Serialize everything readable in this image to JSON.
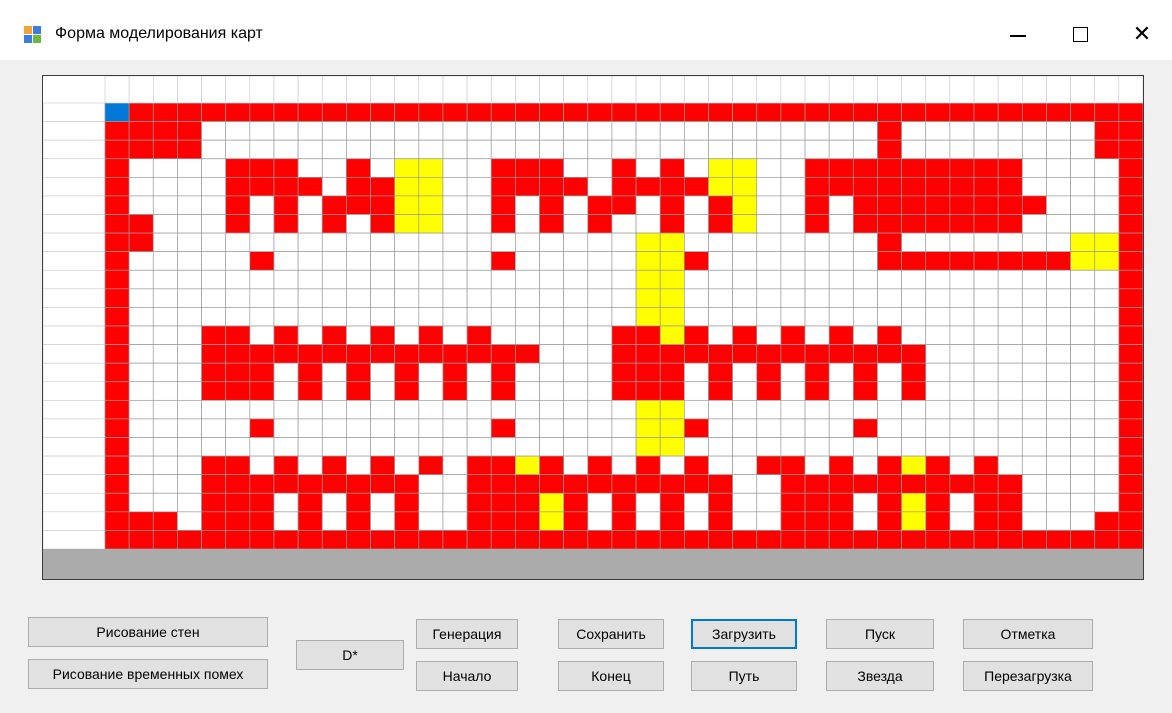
{
  "window": {
    "title": "Форма моделирования карт",
    "controls": {
      "minimize": "—",
      "close": "✕"
    }
  },
  "grid": {
    "cols": 43,
    "rows": 24,
    "header_row": true,
    "header_col": true,
    "colors": {
      "wall": "#ff0000",
      "marker": "#ffff00",
      "start": "#0078d7",
      "empty": "#ffffff",
      "line": "#9a9a9a"
    },
    "start_cell": [
      0,
      0
    ],
    "wall_cells": [
      [
        0,
        0
      ],
      [
        0,
        1
      ],
      [
        0,
        2
      ],
      [
        0,
        3
      ],
      [
        0,
        4
      ],
      [
        0,
        5
      ],
      [
        0,
        6
      ],
      [
        0,
        7
      ],
      [
        0,
        8
      ],
      [
        0,
        9
      ],
      [
        0,
        10
      ],
      [
        0,
        11
      ],
      [
        0,
        12
      ],
      [
        0,
        13
      ],
      [
        0,
        14
      ],
      [
        0,
        15
      ],
      [
        0,
        16
      ],
      [
        0,
        17
      ],
      [
        0,
        18
      ],
      [
        0,
        19
      ],
      [
        0,
        20
      ],
      [
        0,
        21
      ],
      [
        0,
        22
      ],
      [
        0,
        23
      ],
      [
        0,
        24
      ],
      [
        0,
        25
      ],
      [
        0,
        26
      ],
      [
        0,
        27
      ],
      [
        0,
        28
      ],
      [
        0,
        29
      ],
      [
        0,
        30
      ],
      [
        0,
        31
      ],
      [
        0,
        32
      ],
      [
        0,
        33
      ],
      [
        0,
        34
      ],
      [
        0,
        35
      ],
      [
        0,
        36
      ],
      [
        0,
        37
      ],
      [
        0,
        38
      ],
      [
        0,
        39
      ],
      [
        0,
        40
      ],
      [
        0,
        41
      ],
      [
        0,
        42
      ],
      [
        1,
        0
      ],
      [
        1,
        1
      ],
      [
        1,
        2
      ],
      [
        1,
        3
      ],
      [
        1,
        41
      ],
      [
        1,
        42
      ],
      [
        2,
        0
      ],
      [
        2,
        1
      ],
      [
        2,
        2
      ],
      [
        2,
        3
      ],
      [
        2,
        41
      ],
      [
        2,
        42
      ],
      [
        22,
        0
      ],
      [
        22,
        1
      ],
      [
        22,
        2
      ],
      [
        22,
        41
      ],
      [
        22,
        42
      ],
      [
        23,
        0
      ],
      [
        23,
        1
      ],
      [
        23,
        2
      ],
      [
        23,
        3
      ],
      [
        23,
        4
      ],
      [
        23,
        5
      ],
      [
        23,
        6
      ],
      [
        23,
        7
      ],
      [
        23,
        8
      ],
      [
        23,
        9
      ],
      [
        23,
        10
      ],
      [
        23,
        11
      ],
      [
        23,
        12
      ],
      [
        23,
        13
      ],
      [
        23,
        14
      ],
      [
        23,
        15
      ],
      [
        23,
        16
      ],
      [
        23,
        17
      ],
      [
        23,
        18
      ],
      [
        23,
        19
      ],
      [
        23,
        20
      ],
      [
        23,
        21
      ],
      [
        23,
        22
      ],
      [
        23,
        23
      ],
      [
        23,
        24
      ],
      [
        23,
        25
      ],
      [
        23,
        26
      ],
      [
        23,
        27
      ],
      [
        23,
        28
      ],
      [
        23,
        29
      ],
      [
        23,
        30
      ],
      [
        23,
        31
      ],
      [
        23,
        32
      ],
      [
        23,
        33
      ],
      [
        23,
        34
      ],
      [
        23,
        35
      ],
      [
        23,
        36
      ],
      [
        23,
        37
      ],
      [
        23,
        38
      ],
      [
        23,
        39
      ],
      [
        23,
        40
      ],
      [
        23,
        41
      ],
      [
        23,
        42
      ],
      [
        3,
        0
      ],
      [
        4,
        0
      ],
      [
        5,
        0
      ],
      [
        6,
        0
      ],
      [
        7,
        0
      ],
      [
        8,
        0
      ],
      [
        9,
        0
      ],
      [
        10,
        0
      ],
      [
        11,
        0
      ],
      [
        12,
        0
      ],
      [
        13,
        0
      ],
      [
        14,
        0
      ],
      [
        15,
        0
      ],
      [
        16,
        0
      ],
      [
        17,
        0
      ],
      [
        18,
        0
      ],
      [
        19,
        0
      ],
      [
        20,
        0
      ],
      [
        21,
        0
      ],
      [
        3,
        42
      ],
      [
        4,
        42
      ],
      [
        5,
        42
      ],
      [
        6,
        42
      ],
      [
        7,
        42
      ],
      [
        8,
        42
      ],
      [
        9,
        42
      ],
      [
        10,
        42
      ],
      [
        11,
        42
      ],
      [
        12,
        42
      ],
      [
        13,
        42
      ],
      [
        14,
        42
      ],
      [
        15,
        42
      ],
      [
        16,
        42
      ],
      [
        17,
        42
      ],
      [
        18,
        42
      ],
      [
        19,
        42
      ],
      [
        20,
        42
      ],
      [
        21,
        42
      ],
      [
        6,
        1
      ],
      [
        7,
        1
      ],
      [
        3,
        5
      ],
      [
        3,
        6
      ],
      [
        3,
        7
      ],
      [
        3,
        10
      ],
      [
        3,
        16
      ],
      [
        3,
        17
      ],
      [
        3,
        18
      ],
      [
        3,
        21
      ],
      [
        3,
        23
      ],
      [
        3,
        29
      ],
      [
        3,
        30
      ],
      [
        3,
        31
      ],
      [
        3,
        33
      ],
      [
        3,
        35
      ],
      [
        3,
        37
      ],
      [
        4,
        5
      ],
      [
        4,
        6
      ],
      [
        4,
        7
      ],
      [
        4,
        8
      ],
      [
        4,
        10
      ],
      [
        4,
        11
      ],
      [
        4,
        16
      ],
      [
        4,
        17
      ],
      [
        4,
        18
      ],
      [
        4,
        19
      ],
      [
        4,
        21
      ],
      [
        4,
        22
      ],
      [
        4,
        23
      ],
      [
        4,
        24
      ],
      [
        4,
        29
      ],
      [
        4,
        30
      ],
      [
        4,
        31
      ],
      [
        4,
        32
      ],
      [
        4,
        33
      ],
      [
        4,
        34
      ],
      [
        4,
        35
      ],
      [
        4,
        36
      ],
      [
        4,
        37
      ],
      [
        5,
        5
      ],
      [
        5,
        7
      ],
      [
        5,
        9
      ],
      [
        5,
        10
      ],
      [
        5,
        11
      ],
      [
        5,
        16
      ],
      [
        5,
        18
      ],
      [
        5,
        20
      ],
      [
        5,
        21
      ],
      [
        5,
        23
      ],
      [
        5,
        25
      ],
      [
        5,
        29
      ],
      [
        5,
        31
      ],
      [
        5,
        33
      ],
      [
        5,
        35
      ],
      [
        5,
        37
      ],
      [
        6,
        5
      ],
      [
        6,
        7
      ],
      [
        6,
        9
      ],
      [
        6,
        11
      ],
      [
        6,
        16
      ],
      [
        6,
        18
      ],
      [
        6,
        20
      ],
      [
        6,
        23
      ],
      [
        6,
        25
      ],
      [
        6,
        29
      ],
      [
        6,
        31
      ],
      [
        6,
        33
      ],
      [
        6,
        35
      ],
      [
        6,
        37
      ],
      [
        8,
        6
      ],
      [
        8,
        16
      ],
      [
        8,
        24
      ],
      [
        12,
        4
      ],
      [
        12,
        5
      ],
      [
        12,
        7
      ],
      [
        12,
        9
      ],
      [
        12,
        11
      ],
      [
        12,
        13
      ],
      [
        12,
        15
      ],
      [
        12,
        21
      ],
      [
        12,
        22
      ],
      [
        12,
        24
      ],
      [
        12,
        26
      ],
      [
        12,
        28
      ],
      [
        12,
        30
      ],
      [
        12,
        32
      ],
      [
        13,
        4
      ],
      [
        13,
        5
      ],
      [
        13,
        6
      ],
      [
        13,
        7
      ],
      [
        13,
        8
      ],
      [
        13,
        9
      ],
      [
        13,
        10
      ],
      [
        13,
        11
      ],
      [
        13,
        12
      ],
      [
        13,
        13
      ],
      [
        13,
        14
      ],
      [
        13,
        15
      ],
      [
        13,
        16
      ],
      [
        13,
        17
      ],
      [
        13,
        21
      ],
      [
        13,
        22
      ],
      [
        13,
        23
      ],
      [
        13,
        24
      ],
      [
        13,
        25
      ],
      [
        13,
        26
      ],
      [
        13,
        27
      ],
      [
        13,
        28
      ],
      [
        13,
        29
      ],
      [
        13,
        30
      ],
      [
        13,
        31
      ],
      [
        13,
        32
      ],
      [
        13,
        33
      ],
      [
        14,
        4
      ],
      [
        14,
        5
      ],
      [
        14,
        6
      ],
      [
        14,
        8
      ],
      [
        14,
        10
      ],
      [
        14,
        12
      ],
      [
        14,
        14
      ],
      [
        14,
        16
      ],
      [
        14,
        21
      ],
      [
        14,
        22
      ],
      [
        14,
        23
      ],
      [
        14,
        25
      ],
      [
        14,
        27
      ],
      [
        14,
        29
      ],
      [
        14,
        31
      ],
      [
        14,
        33
      ],
      [
        15,
        4
      ],
      [
        15,
        5
      ],
      [
        15,
        6
      ],
      [
        15,
        8
      ],
      [
        15,
        10
      ],
      [
        15,
        12
      ],
      [
        15,
        14
      ],
      [
        15,
        16
      ],
      [
        15,
        21
      ],
      [
        15,
        22
      ],
      [
        15,
        23
      ],
      [
        15,
        25
      ],
      [
        15,
        27
      ],
      [
        15,
        29
      ],
      [
        15,
        31
      ],
      [
        15,
        33
      ],
      [
        17,
        6
      ],
      [
        17,
        16
      ],
      [
        17,
        24
      ],
      [
        17,
        31
      ],
      [
        19,
        4
      ],
      [
        19,
        5
      ],
      [
        19,
        7
      ],
      [
        19,
        9
      ],
      [
        19,
        11
      ],
      [
        19,
        13
      ],
      [
        19,
        15
      ],
      [
        19,
        16
      ],
      [
        19,
        18
      ],
      [
        19,
        20
      ],
      [
        19,
        22
      ],
      [
        19,
        24
      ],
      [
        19,
        27
      ],
      [
        19,
        28
      ],
      [
        19,
        30
      ],
      [
        19,
        32
      ],
      [
        19,
        34
      ],
      [
        19,
        36
      ],
      [
        20,
        4
      ],
      [
        20,
        5
      ],
      [
        20,
        6
      ],
      [
        20,
        7
      ],
      [
        20,
        8
      ],
      [
        20,
        9
      ],
      [
        20,
        10
      ],
      [
        20,
        11
      ],
      [
        20,
        12
      ],
      [
        20,
        15
      ],
      [
        20,
        16
      ],
      [
        20,
        17
      ],
      [
        20,
        18
      ],
      [
        20,
        19
      ],
      [
        20,
        20
      ],
      [
        20,
        21
      ],
      [
        20,
        22
      ],
      [
        20,
        23
      ],
      [
        20,
        24
      ],
      [
        20,
        25
      ],
      [
        20,
        28
      ],
      [
        20,
        29
      ],
      [
        20,
        30
      ],
      [
        20,
        31
      ],
      [
        20,
        32
      ],
      [
        20,
        33
      ],
      [
        20,
        34
      ],
      [
        20,
        35
      ],
      [
        20,
        36
      ],
      [
        20,
        37
      ],
      [
        21,
        4
      ],
      [
        21,
        5
      ],
      [
        21,
        6
      ],
      [
        21,
        8
      ],
      [
        21,
        10
      ],
      [
        21,
        12
      ],
      [
        21,
        15
      ],
      [
        21,
        16
      ],
      [
        21,
        17
      ],
      [
        21,
        19
      ],
      [
        21,
        21
      ],
      [
        21,
        23
      ],
      [
        21,
        25
      ],
      [
        21,
        28
      ],
      [
        21,
        29
      ],
      [
        21,
        30
      ],
      [
        21,
        32
      ],
      [
        21,
        34
      ],
      [
        21,
        36
      ],
      [
        21,
        37
      ],
      [
        22,
        4
      ],
      [
        22,
        5
      ],
      [
        22,
        6
      ],
      [
        22,
        8
      ],
      [
        22,
        10
      ],
      [
        22,
        12
      ],
      [
        22,
        15
      ],
      [
        22,
        16
      ],
      [
        22,
        17
      ],
      [
        22,
        19
      ],
      [
        22,
        21
      ],
      [
        22,
        23
      ],
      [
        22,
        25
      ],
      [
        22,
        28
      ],
      [
        22,
        29
      ],
      [
        22,
        30
      ],
      [
        22,
        32
      ],
      [
        22,
        34
      ],
      [
        22,
        36
      ],
      [
        22,
        37
      ],
      [
        1,
        32
      ],
      [
        2,
        32
      ],
      [
        3,
        32
      ],
      [
        4,
        32
      ],
      [
        5,
        32
      ],
      [
        6,
        32
      ],
      [
        7,
        32
      ],
      [
        8,
        32
      ],
      [
        8,
        33
      ],
      [
        8,
        34
      ],
      [
        8,
        35
      ],
      [
        8,
        36
      ],
      [
        8,
        37
      ],
      [
        8,
        38
      ],
      [
        8,
        39
      ],
      [
        3,
        34
      ],
      [
        3,
        36
      ],
      [
        4,
        34
      ],
      [
        4,
        36
      ],
      [
        5,
        34
      ],
      [
        5,
        36
      ],
      [
        6,
        34
      ],
      [
        6,
        36
      ],
      [
        5,
        38
      ]
    ],
    "marker_cells": [
      [
        3,
        12
      ],
      [
        3,
        13
      ],
      [
        4,
        12
      ],
      [
        4,
        13
      ],
      [
        5,
        12
      ],
      [
        5,
        13
      ],
      [
        6,
        12
      ],
      [
        6,
        13
      ],
      [
        3,
        25
      ],
      [
        3,
        26
      ],
      [
        4,
        25
      ],
      [
        4,
        26
      ],
      [
        5,
        25
      ],
      [
        5,
        26
      ],
      [
        6,
        25
      ],
      [
        6,
        26
      ],
      [
        3,
        35
      ],
      [
        4,
        35
      ],
      [
        5,
        35
      ],
      [
        6,
        35
      ],
      [
        7,
        40
      ],
      [
        7,
        41
      ],
      [
        8,
        40
      ],
      [
        8,
        41
      ],
      [
        7,
        22
      ],
      [
        7,
        23
      ],
      [
        8,
        22
      ],
      [
        8,
        23
      ],
      [
        9,
        22
      ],
      [
        9,
        23
      ],
      [
        10,
        22
      ],
      [
        10,
        23
      ],
      [
        11,
        22
      ],
      [
        11,
        23
      ],
      [
        12,
        22
      ],
      [
        12,
        23
      ],
      [
        13,
        22
      ],
      [
        13,
        23
      ],
      [
        14,
        22
      ],
      [
        14,
        23
      ],
      [
        15,
        22
      ],
      [
        15,
        23
      ],
      [
        16,
        22
      ],
      [
        16,
        23
      ],
      [
        17,
        22
      ],
      [
        17,
        23
      ],
      [
        18,
        22
      ],
      [
        18,
        23
      ],
      [
        19,
        16
      ],
      [
        19,
        17
      ],
      [
        19,
        18
      ],
      [
        20,
        16
      ],
      [
        20,
        17
      ],
      [
        20,
        18
      ],
      [
        21,
        16
      ],
      [
        21,
        17
      ],
      [
        21,
        18
      ],
      [
        22,
        16
      ],
      [
        22,
        17
      ],
      [
        22,
        18
      ],
      [
        19,
        32
      ],
      [
        19,
        33
      ],
      [
        19,
        34
      ],
      [
        20,
        32
      ],
      [
        20,
        33
      ],
      [
        20,
        34
      ],
      [
        21,
        32
      ],
      [
        21,
        33
      ],
      [
        21,
        34
      ],
      [
        22,
        32
      ],
      [
        22,
        33
      ],
      [
        22,
        34
      ]
    ]
  },
  "buttons": [
    {
      "id": "draw-walls",
      "label": "Рисование стен"
    },
    {
      "id": "draw-temp",
      "label": "Рисование временных помех"
    },
    {
      "id": "dstar",
      "label": "D*"
    },
    {
      "id": "generate",
      "label": "Генерация"
    },
    {
      "id": "start",
      "label": "Начало"
    },
    {
      "id": "save",
      "label": "Сохранить"
    },
    {
      "id": "end",
      "label": "Конец"
    },
    {
      "id": "load",
      "label": "Загрузить"
    },
    {
      "id": "path",
      "label": "Путь"
    },
    {
      "id": "run",
      "label": "Пуск"
    },
    {
      "id": "star",
      "label": "Звезда"
    },
    {
      "id": "mark",
      "label": "Отметка"
    },
    {
      "id": "reload",
      "label": "Перезагрузка"
    }
  ]
}
